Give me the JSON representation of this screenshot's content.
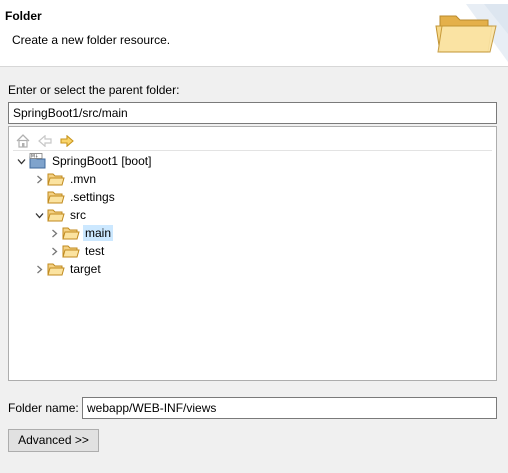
{
  "header": {
    "title": "Folder",
    "subtitle": "Create a new folder resource.",
    "icon": "open-folder-icon"
  },
  "parent": {
    "label": "Enter or select the parent folder:",
    "value": "SpringBoot1/src/main"
  },
  "toolbar": {
    "home_icon": "home-icon",
    "back_icon": "back-arrow-icon",
    "forward_icon": "forward-arrow-icon"
  },
  "tree": {
    "nodes": [
      {
        "label": "SpringBoot1 [boot]",
        "icon": "project-icon",
        "expanded": true,
        "depth": 0
      },
      {
        "label": ".mvn",
        "icon": "folder-icon",
        "expanded": false,
        "depth": 1
      },
      {
        "label": ".settings",
        "icon": "folder-icon",
        "expanded": null,
        "depth": 1
      },
      {
        "label": "src",
        "icon": "folder-icon",
        "expanded": true,
        "depth": 1
      },
      {
        "label": "main",
        "icon": "folder-icon",
        "expanded": false,
        "depth": 2,
        "selected": true
      },
      {
        "label": "test",
        "icon": "folder-icon",
        "expanded": false,
        "depth": 2
      },
      {
        "label": "target",
        "icon": "folder-icon",
        "expanded": false,
        "depth": 1
      }
    ]
  },
  "folder_name": {
    "label": "Folder name:",
    "value": "webapp/WEB-INF/views"
  },
  "advanced_button": "Advanced >>",
  "colors": {
    "selection": "#cce8ff",
    "folder": "#f3c25b",
    "arrow": "#e8b426"
  }
}
